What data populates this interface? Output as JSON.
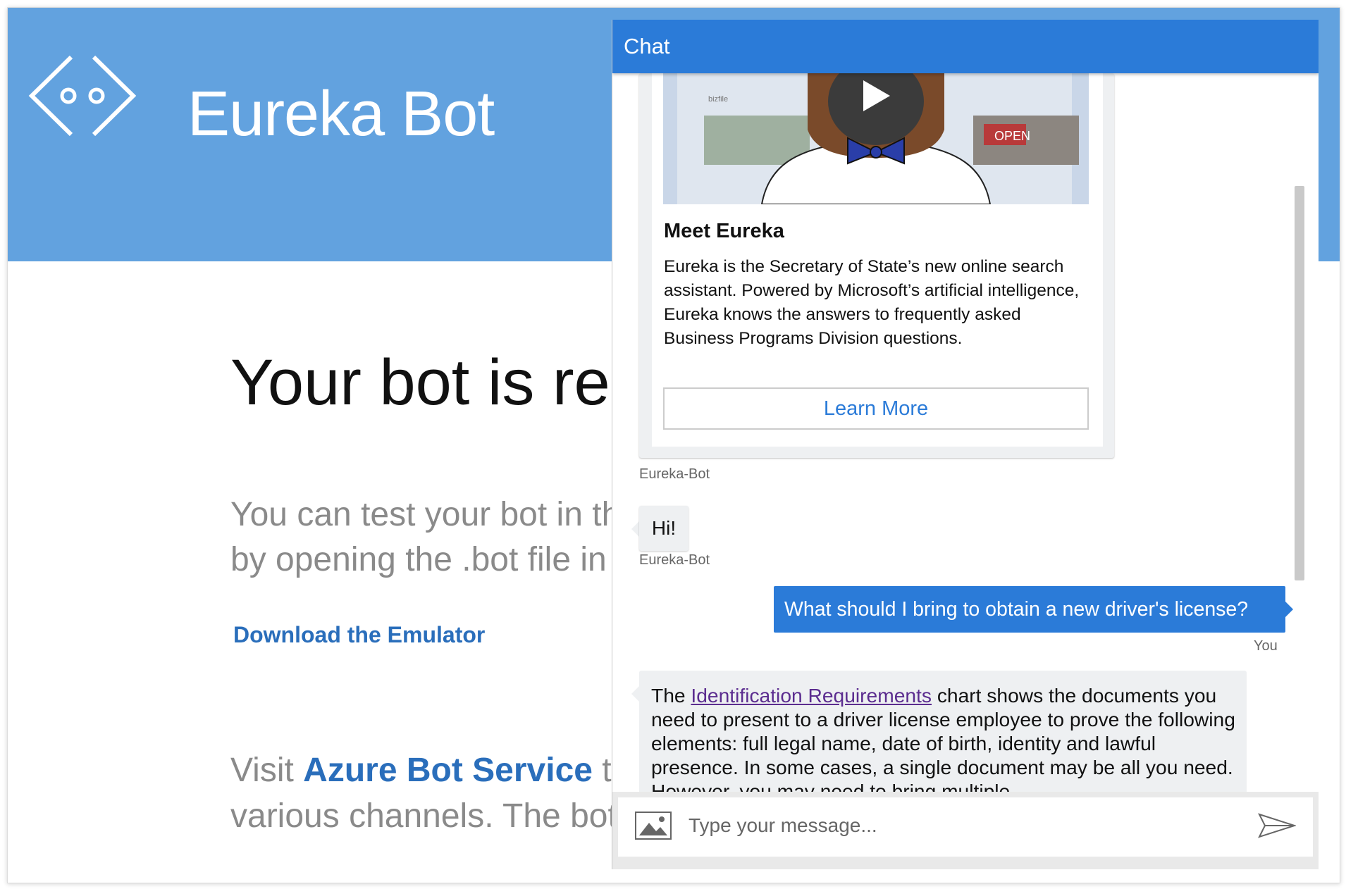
{
  "site": {
    "brand": "Eureka Bot",
    "headline": "Your bot is rea",
    "subtitle_line1": "You can test your bot in the",
    "subtitle_line2": "by opening the .bot file in th",
    "download_link": "Download the Emulator",
    "visit_prefix": "Visit ",
    "visit_link": "Azure Bot Service",
    "visit_suffix": " t",
    "visit_line2": "various channels. The bot's"
  },
  "chat": {
    "title": "Chat",
    "card": {
      "title": "Meet Eureka",
      "text": "Eureka is the Secretary of State’s new online search assistant. Powered by Microsoft’s artificial intelligence, Eureka knows the answers to frequently asked Business Programs Division questions.",
      "button": "Learn More",
      "thumb_small_text": "bizfile",
      "thumb_sign": "OPEN"
    },
    "messages": [
      {
        "sender": "Eureka-Bot",
        "text": "Hi!"
      },
      {
        "sender": "You",
        "text": "What should I bring to obtain a new driver's license?"
      },
      {
        "sender": "Eureka-Bot",
        "prefix": "The ",
        "link": "Identification Requirements",
        "text": " chart shows the documents you need to present to a driver license employee to prove the following elements: full legal name, date of birth, identity and lawful presence. In some cases, a single document may be all you need. However, you may need to bring multiple"
      }
    ],
    "card_sender": "Eureka-Bot",
    "input_placeholder": "Type your message..."
  },
  "colors": {
    "hero": "#62a2df",
    "chat_header": "#2b7bd8",
    "link": "#2a6ebb"
  },
  "icons": [
    "logo-brackets-icon",
    "play-icon",
    "image-upload-icon",
    "send-icon"
  ]
}
